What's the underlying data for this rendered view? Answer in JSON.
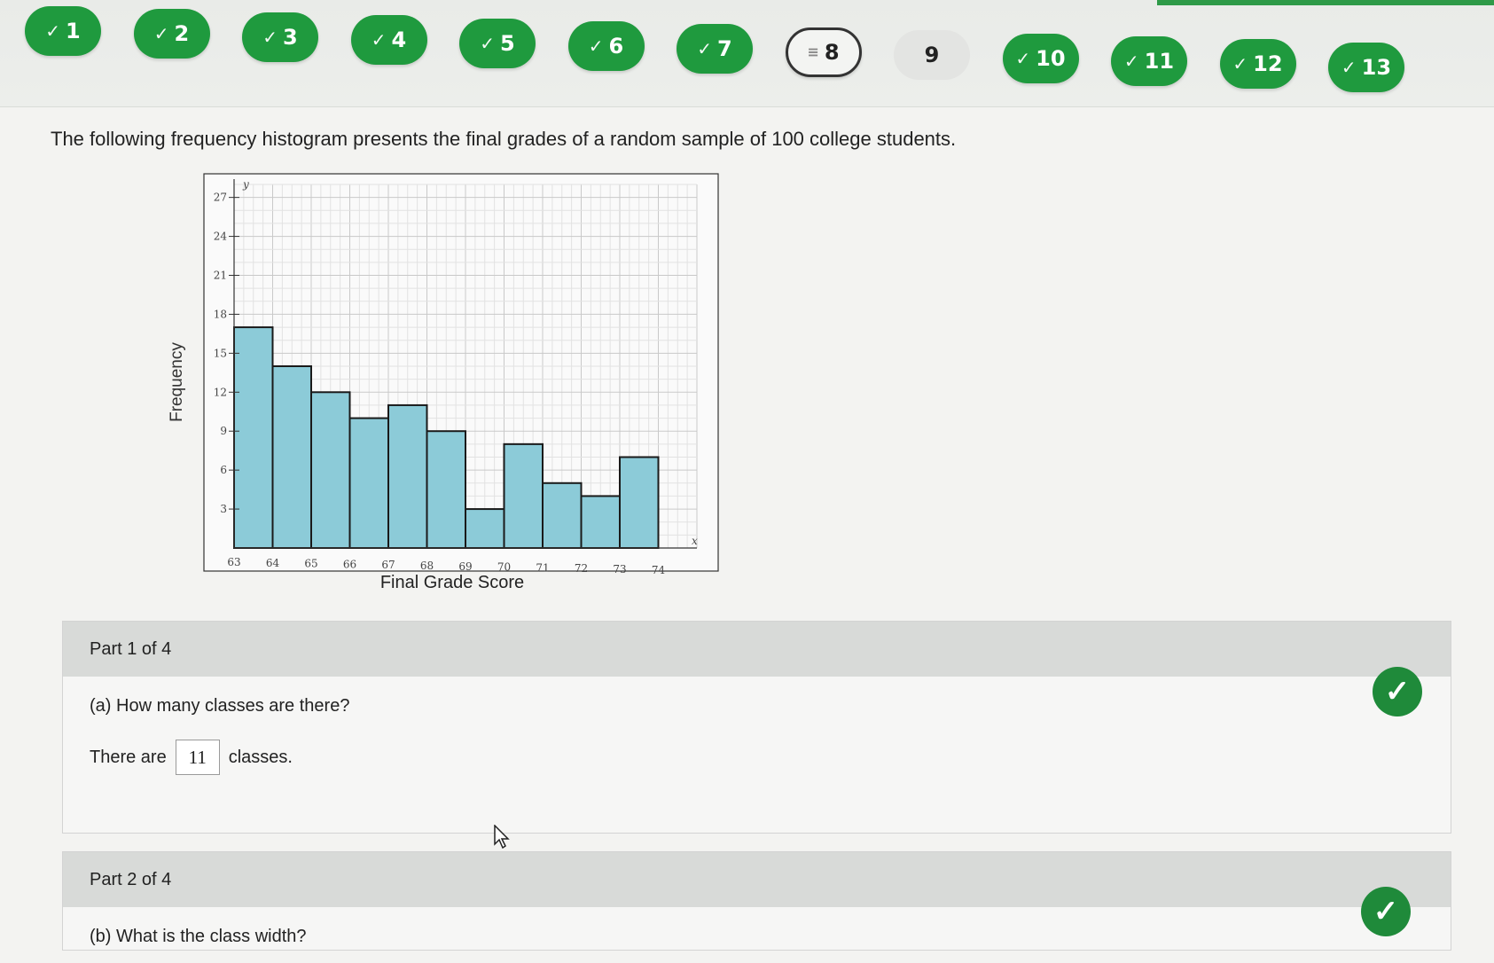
{
  "nav": {
    "questions": [
      {
        "label": "1",
        "status": "correct"
      },
      {
        "label": "2",
        "status": "correct"
      },
      {
        "label": "3",
        "status": "correct"
      },
      {
        "label": "4",
        "status": "correct"
      },
      {
        "label": "5",
        "status": "correct"
      },
      {
        "label": "6",
        "status": "correct"
      },
      {
        "label": "7",
        "status": "correct"
      },
      {
        "label": "8",
        "status": "current"
      },
      {
        "label": "9",
        "status": "unanswered"
      },
      {
        "label": "10",
        "status": "correct"
      },
      {
        "label": "11",
        "status": "correct"
      },
      {
        "label": "12",
        "status": "correct"
      },
      {
        "label": "13",
        "status": "correct"
      }
    ],
    "colors": {
      "correct": "#1f9a3e",
      "current_border": "#333333",
      "unanswered": "#e3e4e2"
    },
    "check_icon": "check-icon",
    "pen_icon": "pencil-icon"
  },
  "prompt": "The following frequency histogram presents the final grades of a random sample of 100 college students.",
  "chart_data": {
    "type": "bar",
    "categories": [
      "63-64",
      "64-65",
      "65-66",
      "66-67",
      "67-68",
      "68-69",
      "69-70",
      "70-71",
      "71-72",
      "72-73",
      "73-74"
    ],
    "bin_edges": [
      63,
      64,
      65,
      66,
      67,
      68,
      69,
      70,
      71,
      72,
      73,
      74
    ],
    "values": [
      17,
      14,
      12,
      10,
      11,
      9,
      3,
      8,
      5,
      4,
      7
    ],
    "xlabel": "Final Grade Score",
    "ylabel": "Frequency",
    "y_axis_letter": "y",
    "x_axis_letter": "x",
    "y_ticks": [
      3,
      6,
      9,
      12,
      15,
      18,
      21,
      24,
      27
    ],
    "x_ticks": [
      63,
      64,
      65,
      66,
      67,
      68,
      69,
      70,
      71,
      72,
      73,
      74
    ],
    "ylim": [
      0,
      28
    ],
    "xlim": [
      63,
      75
    ],
    "grid": true,
    "bar_color": "#8ccbd8",
    "bar_edge": "#1a1a1a"
  },
  "parts": [
    {
      "header": "Part 1 of 4",
      "question": "(a) How many classes are there?",
      "answer_prefix": "There are",
      "answer_value": "11",
      "answer_suffix": "classes.",
      "status_icon": "checkmark-icon"
    },
    {
      "header": "Part 2 of 4",
      "question": "(b) What is the class width?",
      "status_icon": "checkmark-icon"
    }
  ]
}
